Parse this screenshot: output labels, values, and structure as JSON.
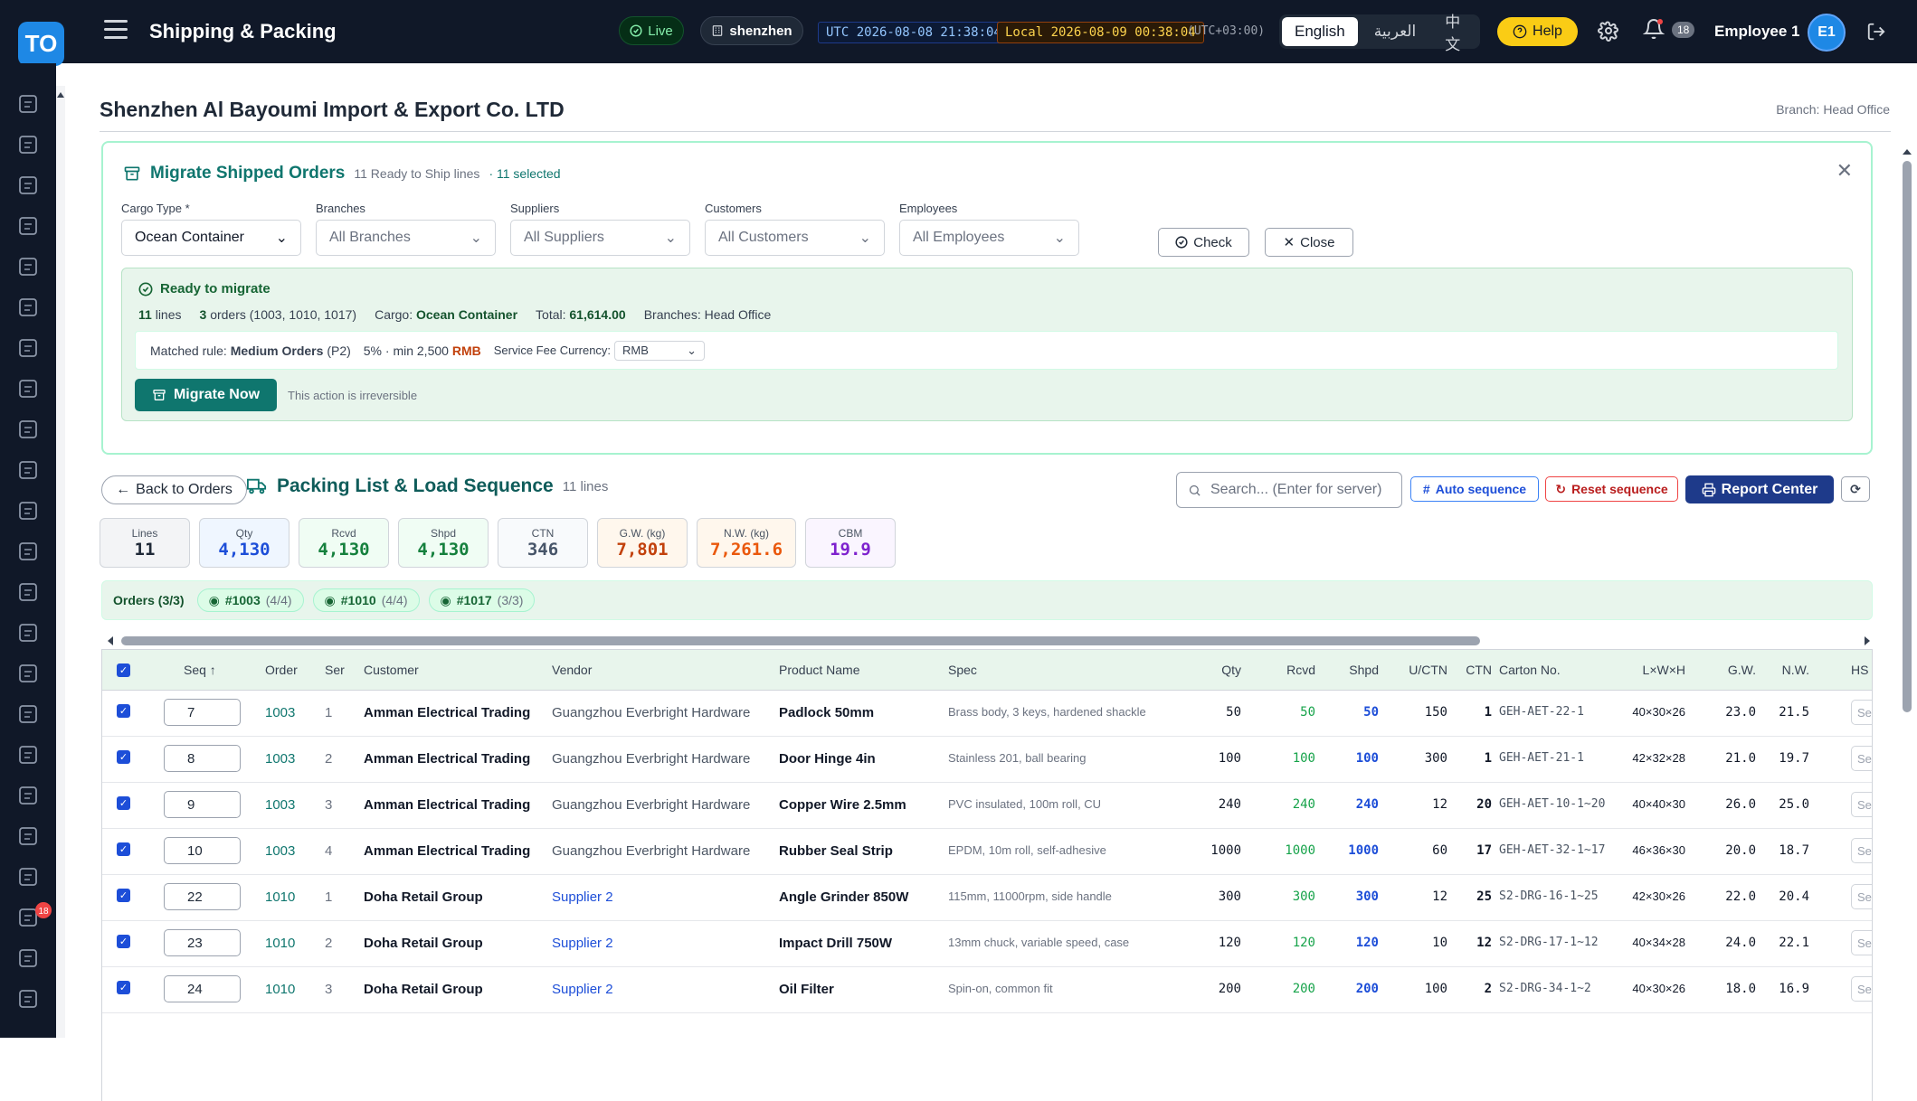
{
  "app": {
    "logo": "TO",
    "title": "Shipping & Packing"
  },
  "topbar": {
    "live": "Live",
    "location": "shenzhen",
    "utc": "UTC 2026-08-08 21:38:04",
    "local": "Local 2026-08-09 00:38:04",
    "tz": "(UTC+03:00)",
    "languages": [
      {
        "label": "English",
        "active": true
      },
      {
        "label": "العربية",
        "active": false
      },
      {
        "label": "中文",
        "active": false
      }
    ],
    "help": "Help",
    "notifications": "18",
    "employee": "Employee 1",
    "avatar": "E1"
  },
  "sidebar": {
    "icons": [
      "dashboard-icon",
      "clipboard-icon",
      "cart-icon",
      "checklist-icon",
      "archive-icon",
      "package-icon",
      "layers-icon",
      "users-icon",
      "id-card-icon",
      "accessibility-icon",
      "vehicle-icon",
      "invoice-icon",
      "wallet-icon",
      "bank-icon",
      "document-icon",
      "book-icon",
      "dollar-icon",
      "chart-icon",
      "search-person-icon",
      "inbox-icon",
      "send-icon",
      "team-icon",
      "clock-icon"
    ],
    "badge": "18"
  },
  "page": {
    "company": "Shenzhen Al Bayoumi Import & Export Co. LTD",
    "branch": "Branch: Head Office"
  },
  "migrate": {
    "title": "Migrate Shipped Orders",
    "subtitle": "11 Ready to Ship lines",
    "selected": "· 11 selected",
    "filters": [
      {
        "label": "Cargo Type *",
        "value": "Ocean Container"
      },
      {
        "label": "Branches",
        "value": "All Branches"
      },
      {
        "label": "Suppliers",
        "value": "All Suppliers"
      },
      {
        "label": "Customers",
        "value": "All Customers"
      },
      {
        "label": "Employees",
        "value": "All Employees"
      }
    ],
    "check": "Check",
    "close": "Close",
    "ready_title": "Ready to migrate",
    "lines_n": "11",
    "lines_t": "lines",
    "orders_n": "3",
    "orders_t": "orders (1003, 1010, 1017)",
    "cargo_l": "Cargo:",
    "cargo_v": "Ocean Container",
    "total_l": "Total:",
    "total_v": "61,614.00",
    "branches": "Branches: Head Office",
    "rule_l": "Matched rule:",
    "rule_v": "Medium Orders",
    "rule_p": "(P2)",
    "rule_fee": "5% · min 2,500",
    "rule_cur": "RMB",
    "fee_l": "Service Fee Currency:",
    "fee_v": "RMB",
    "migrate_now": "Migrate Now",
    "irreversible": "This action is irreversible"
  },
  "packing": {
    "back": "Back to Orders",
    "title": "Packing List & Load Sequence",
    "count": "11 lines",
    "search_placeholder": "Search... (Enter for server)",
    "auto": "Auto sequence",
    "reset": "Reset sequence",
    "report": "Report Center",
    "stats": [
      {
        "label": "Lines",
        "value": "11",
        "color": "#1f2937",
        "bg": "#f3f4f6"
      },
      {
        "label": "Qty",
        "value": "4,130",
        "color": "#1d4ed8",
        "bg": "#eff6ff"
      },
      {
        "label": "Rcvd",
        "value": "4,130",
        "color": "#15803d",
        "bg": "#f0fdf4"
      },
      {
        "label": "Shpd",
        "value": "4,130",
        "color": "#15803d",
        "bg": "#f0fdf4"
      },
      {
        "label": "CTN",
        "value": "346",
        "color": "#475569",
        "bg": "#f8fafc"
      },
      {
        "label": "G.W. (kg)",
        "value": "7,801",
        "color": "#c2410c",
        "bg": "#fff7ed"
      },
      {
        "label": "N.W. (kg)",
        "value": "7,261.6",
        "color": "#ea580c",
        "bg": "#fff7ed"
      },
      {
        "label": "CBM",
        "value": "19.9",
        "color": "#7e22ce",
        "bg": "#faf5ff"
      }
    ],
    "orders_title": "Orders (3/3)",
    "order_chips": [
      {
        "id": "#1003",
        "n": "(4/4)"
      },
      {
        "id": "#1010",
        "n": "(4/4)"
      },
      {
        "id": "#1017",
        "n": "(3/3)"
      }
    ]
  },
  "table": {
    "headers": [
      "Seq ↑",
      "Order",
      "Ser",
      "Customer",
      "Vendor",
      "Product Name",
      "Spec",
      "Qty",
      "Rcvd",
      "Shpd",
      "U/CTN",
      "CTN",
      "Carton No.",
      "L×W×H",
      "G.W.",
      "N.W.",
      "HS C"
    ],
    "rows": [
      {
        "seq": "7",
        "order": "1003",
        "ser": "1",
        "customer": "Amman Electrical Trading",
        "vendor": "Guangzhou Everbright Hardware",
        "product": "Padlock 50mm",
        "spec": "Brass body, 3 keys, hardened shackle",
        "qty": "50",
        "rcvd": "50",
        "shpd": "50",
        "uctn": "150",
        "ctn": "1",
        "carton": "GEH-AET-22-1",
        "dims": "40×30×26",
        "gw": "23.0",
        "nw": "21.5",
        "hs": "Se"
      },
      {
        "seq": "8",
        "order": "1003",
        "ser": "2",
        "customer": "Amman Electrical Trading",
        "vendor": "Guangzhou Everbright Hardware",
        "product": "Door Hinge 4in",
        "spec": "Stainless 201, ball bearing",
        "qty": "100",
        "rcvd": "100",
        "shpd": "100",
        "uctn": "300",
        "ctn": "1",
        "carton": "GEH-AET-21-1",
        "dims": "42×32×28",
        "gw": "21.0",
        "nw": "19.7",
        "hs": "Se"
      },
      {
        "seq": "9",
        "order": "1003",
        "ser": "3",
        "customer": "Amman Electrical Trading",
        "vendor": "Guangzhou Everbright Hardware",
        "product": "Copper Wire 2.5mm",
        "spec": "PVC insulated, 100m roll, CU",
        "qty": "240",
        "rcvd": "240",
        "shpd": "240",
        "uctn": "12",
        "ctn": "20",
        "carton": "GEH-AET-10-1~20",
        "dims": "40×40×30",
        "gw": "26.0",
        "nw": "25.0",
        "hs": "Se"
      },
      {
        "seq": "10",
        "order": "1003",
        "ser": "4",
        "customer": "Amman Electrical Trading",
        "vendor": "Guangzhou Everbright Hardware",
        "product": "Rubber Seal Strip",
        "spec": "EPDM, 10m roll, self-adhesive",
        "qty": "1000",
        "rcvd": "1000",
        "shpd": "1000",
        "uctn": "60",
        "ctn": "17",
        "carton": "GEH-AET-32-1~17",
        "dims": "46×36×30",
        "gw": "20.0",
        "nw": "18.7",
        "hs": "Se"
      },
      {
        "seq": "22",
        "order": "1010",
        "ser": "1",
        "customer": "Doha Retail Group",
        "vendor": "Supplier 2",
        "product": "Angle Grinder 850W",
        "spec": "115mm, 11000rpm, side handle",
        "qty": "300",
        "rcvd": "300",
        "shpd": "300",
        "uctn": "12",
        "ctn": "25",
        "carton": "S2-DRG-16-1~25",
        "dims": "42×30×26",
        "gw": "22.0",
        "nw": "20.4",
        "hs": "Se"
      },
      {
        "seq": "23",
        "order": "1010",
        "ser": "2",
        "customer": "Doha Retail Group",
        "vendor": "Supplier 2",
        "product": "Impact Drill 750W",
        "spec": "13mm chuck, variable speed, case",
        "qty": "120",
        "rcvd": "120",
        "shpd": "120",
        "uctn": "10",
        "ctn": "12",
        "carton": "S2-DRG-17-1~12",
        "dims": "40×34×28",
        "gw": "24.0",
        "nw": "22.1",
        "hs": "Se"
      },
      {
        "seq": "24",
        "order": "1010",
        "ser": "3",
        "customer": "Doha Retail Group",
        "vendor": "Supplier 2",
        "product": "Oil Filter",
        "spec": "Spin-on, common fit",
        "qty": "200",
        "rcvd": "200",
        "shpd": "200",
        "uctn": "100",
        "ctn": "2",
        "carton": "S2-DRG-34-1~2",
        "dims": "40×30×26",
        "gw": "18.0",
        "nw": "16.9",
        "hs": "Se"
      }
    ]
  }
}
